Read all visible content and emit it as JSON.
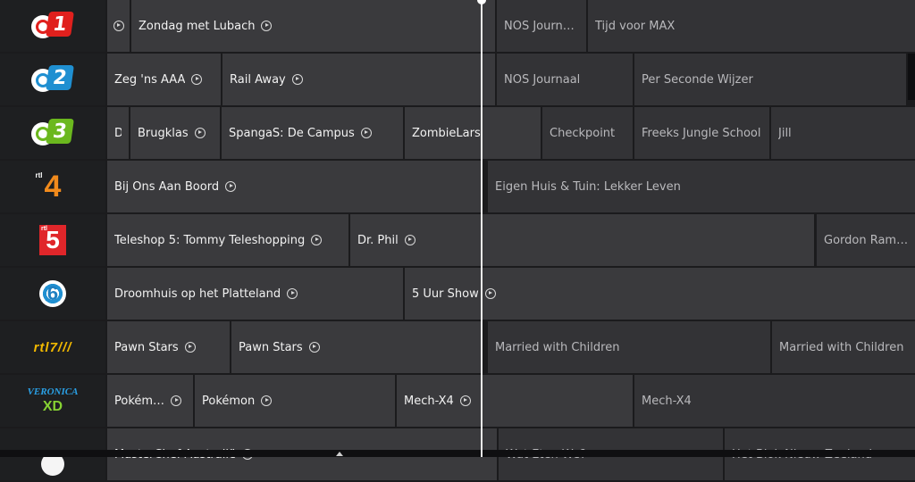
{
  "colors": {
    "cell": "#3a3a3d",
    "cell_future": "#333336",
    "now_line": "#e9e9e9"
  },
  "channels": [
    {
      "logo": {
        "type": "npo",
        "color": "#e0201d",
        "text": "1"
      },
      "programs": [
        {
          "title": "",
          "play": true,
          "kind": "past",
          "l": 120,
          "w": 25
        },
        {
          "title": "Zondag met Lubach",
          "play": true,
          "kind": "past",
          "l": 147,
          "w": 407
        },
        {
          "title": "NOS Journ…",
          "play": false,
          "kind": "future",
          "l": 556,
          "w": 100
        },
        {
          "title": "Tijd voor MAX",
          "play": false,
          "kind": "future",
          "l": 658,
          "w": 366
        }
      ]
    },
    {
      "logo": {
        "type": "npo",
        "color": "#1f8fd1",
        "text": "2"
      },
      "programs": [
        {
          "title": "Zeg 'ns AAA",
          "play": true,
          "kind": "past",
          "l": 120,
          "w": 127
        },
        {
          "title": "Rail Away",
          "play": true,
          "kind": "past",
          "l": 249,
          "w": 305
        },
        {
          "title": "NOS Journaal",
          "play": false,
          "kind": "future",
          "l": 556,
          "w": 152
        },
        {
          "title": "Per Seconde Wijzer",
          "play": false,
          "kind": "future",
          "l": 710,
          "w": 304
        }
      ]
    },
    {
      "logo": {
        "type": "npo",
        "color": "#6bb81e",
        "text": "3"
      },
      "programs": [
        {
          "title": "D",
          "play": false,
          "kind": "past",
          "l": 120,
          "w": 24
        },
        {
          "title": "Brugklas",
          "play": true,
          "kind": "past",
          "l": 146,
          "w": 100
        },
        {
          "title": "SpangaS: De Campus",
          "play": true,
          "kind": "past",
          "l": 248,
          "w": 203
        },
        {
          "title": "ZombieLars",
          "play": false,
          "kind": "past",
          "l": 453,
          "w": 152
        },
        {
          "title": "Checkpoint",
          "play": false,
          "kind": "future",
          "l": 607,
          "w": 101
        },
        {
          "title": "Freeks Jungle School",
          "play": false,
          "kind": "future",
          "l": 710,
          "w": 151
        },
        {
          "title": "Jill",
          "play": false,
          "kind": "future",
          "l": 863,
          "w": 161
        }
      ]
    },
    {
      "logo": {
        "type": "rtl4",
        "text": "4",
        "small": "rtl"
      },
      "programs": [
        {
          "title": "Bij Ons Aan Boord",
          "play": true,
          "kind": "past",
          "l": 120,
          "w": 418
        },
        {
          "title": "Eigen Huis & Tuin: Lekker Leven",
          "play": false,
          "kind": "future",
          "l": 546,
          "w": 478
        }
      ]
    },
    {
      "logo": {
        "type": "rtl5",
        "text": "5",
        "small": "rtl"
      },
      "programs": [
        {
          "title": "Teleshop 5: Tommy Teleshopping",
          "play": true,
          "kind": "past",
          "l": 120,
          "w": 270
        },
        {
          "title": "Dr. Phil",
          "play": true,
          "kind": "past",
          "l": 392,
          "w": 519
        },
        {
          "title": "Gordon Ram…",
          "play": false,
          "kind": "future",
          "l": 914,
          "w": 110
        }
      ]
    },
    {
      "logo": {
        "type": "sbs6",
        "text": "6"
      },
      "programs": [
        {
          "title": "Droomhuis op het Platteland",
          "play": true,
          "kind": "past",
          "l": 120,
          "w": 331
        },
        {
          "title": "5 Uur Show",
          "play": true,
          "kind": "past",
          "l": 453,
          "w": 571
        }
      ]
    },
    {
      "logo": {
        "type": "rtl7",
        "text": "rtl7///"
      },
      "programs": [
        {
          "title": "Pawn Stars",
          "play": true,
          "kind": "past",
          "l": 120,
          "w": 137
        },
        {
          "title": "Pawn Stars",
          "play": true,
          "kind": "past",
          "l": 259,
          "w": 279
        },
        {
          "title": "Married with Children",
          "play": false,
          "kind": "future",
          "l": 546,
          "w": 316
        },
        {
          "title": "Married with Children",
          "play": false,
          "kind": "future",
          "l": 864,
          "w": 160
        }
      ]
    },
    {
      "logo": {
        "type": "veronica",
        "line1": "VERONICA",
        "line2": "XD"
      },
      "programs": [
        {
          "title": "Pokém…",
          "play": true,
          "kind": "past",
          "l": 120,
          "w": 96
        },
        {
          "title": "Pokémon",
          "play": true,
          "kind": "past",
          "l": 218,
          "w": 224
        },
        {
          "title": "Mech-X4",
          "play": true,
          "kind": "past",
          "l": 444,
          "w": 264
        },
        {
          "title": "Mech-X4",
          "play": false,
          "kind": "future",
          "l": 710,
          "w": 314
        }
      ]
    },
    {
      "logo": {
        "type": "circle"
      },
      "programs": [
        {
          "title": "MasterChef Australië",
          "play": true,
          "kind": "past",
          "l": 120,
          "w": 436
        },
        {
          "title": "Wat Eten We?",
          "play": false,
          "kind": "future",
          "l": 558,
          "w": 251
        },
        {
          "title": "Het Blok Nieuw-Zeeland",
          "play": false,
          "kind": "future",
          "l": 811,
          "w": 213
        }
      ]
    }
  ]
}
